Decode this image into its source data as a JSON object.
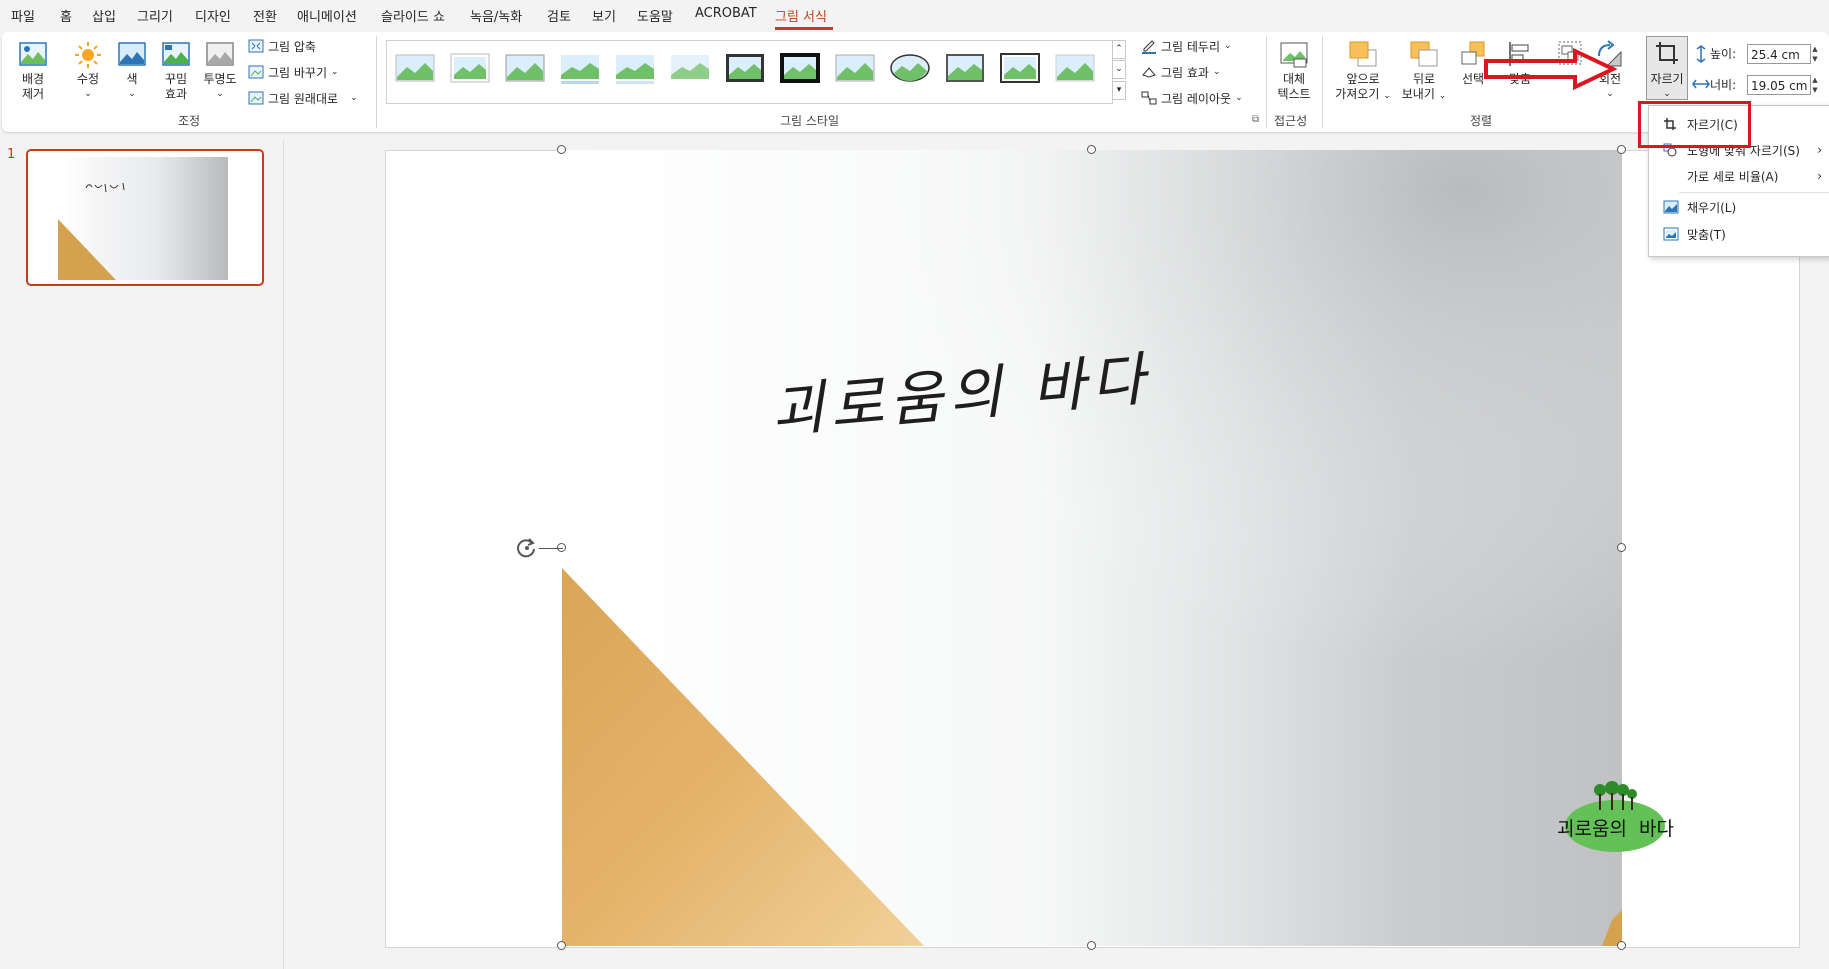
{
  "menu": {
    "tabs": [
      "파일",
      "홈",
      "삽입",
      "그리기",
      "디자인",
      "전환",
      "애니메이션",
      "슬라이드 쇼",
      "녹음/녹화",
      "검토",
      "보기",
      "도움말",
      "ACROBAT",
      "그림 서식"
    ],
    "active_tab": "그림 서식"
  },
  "ribbon": {
    "adjust": {
      "remove_bg_line1": "배경",
      "remove_bg_line2": "제거",
      "corrections": "수정",
      "color": "색",
      "artistic_line1": "꾸밈",
      "artistic_line2": "효과",
      "transparency": "투명도",
      "compress": "그림 압축",
      "change": "그림 바꾸기",
      "reset": "그림 원래대로",
      "group_label": "조정"
    },
    "styles": {
      "border": "그림 테두리",
      "effects": "그림 효과",
      "layout": "그림 레이아웃",
      "group_label": "그림 스타일"
    },
    "accessibility": {
      "alt_line1": "대체",
      "alt_line2": "텍스트",
      "group_label": "접근성"
    },
    "arrange": {
      "bring_line1": "앞으로",
      "bring_line2": "가져오기",
      "send_line1": "뒤로",
      "send_line2": "보내기",
      "selection": "선택",
      "align": "맞춤",
      "rotate": "회전",
      "group_label": "정렬"
    },
    "size": {
      "crop": "자르기",
      "height_label": "높이:",
      "height_value": "25.4 cm",
      "width_label": "너비:",
      "width_value": "19.05 cm"
    }
  },
  "crop_menu": {
    "items": [
      "자르기(C)",
      "도형에 맞춰 자르기(S)",
      "가로 세로 비율(A)",
      "채우기(L)",
      "맞춤(T)"
    ]
  },
  "slides": {
    "current_number": "1"
  },
  "slide_content": {
    "handwriting": "괴로움의 바다",
    "logo_text": "괴로움의  바다"
  },
  "colors": {
    "accent": "#c43e1c",
    "highlight": "#e0141e",
    "logo_green": "#63c158"
  }
}
